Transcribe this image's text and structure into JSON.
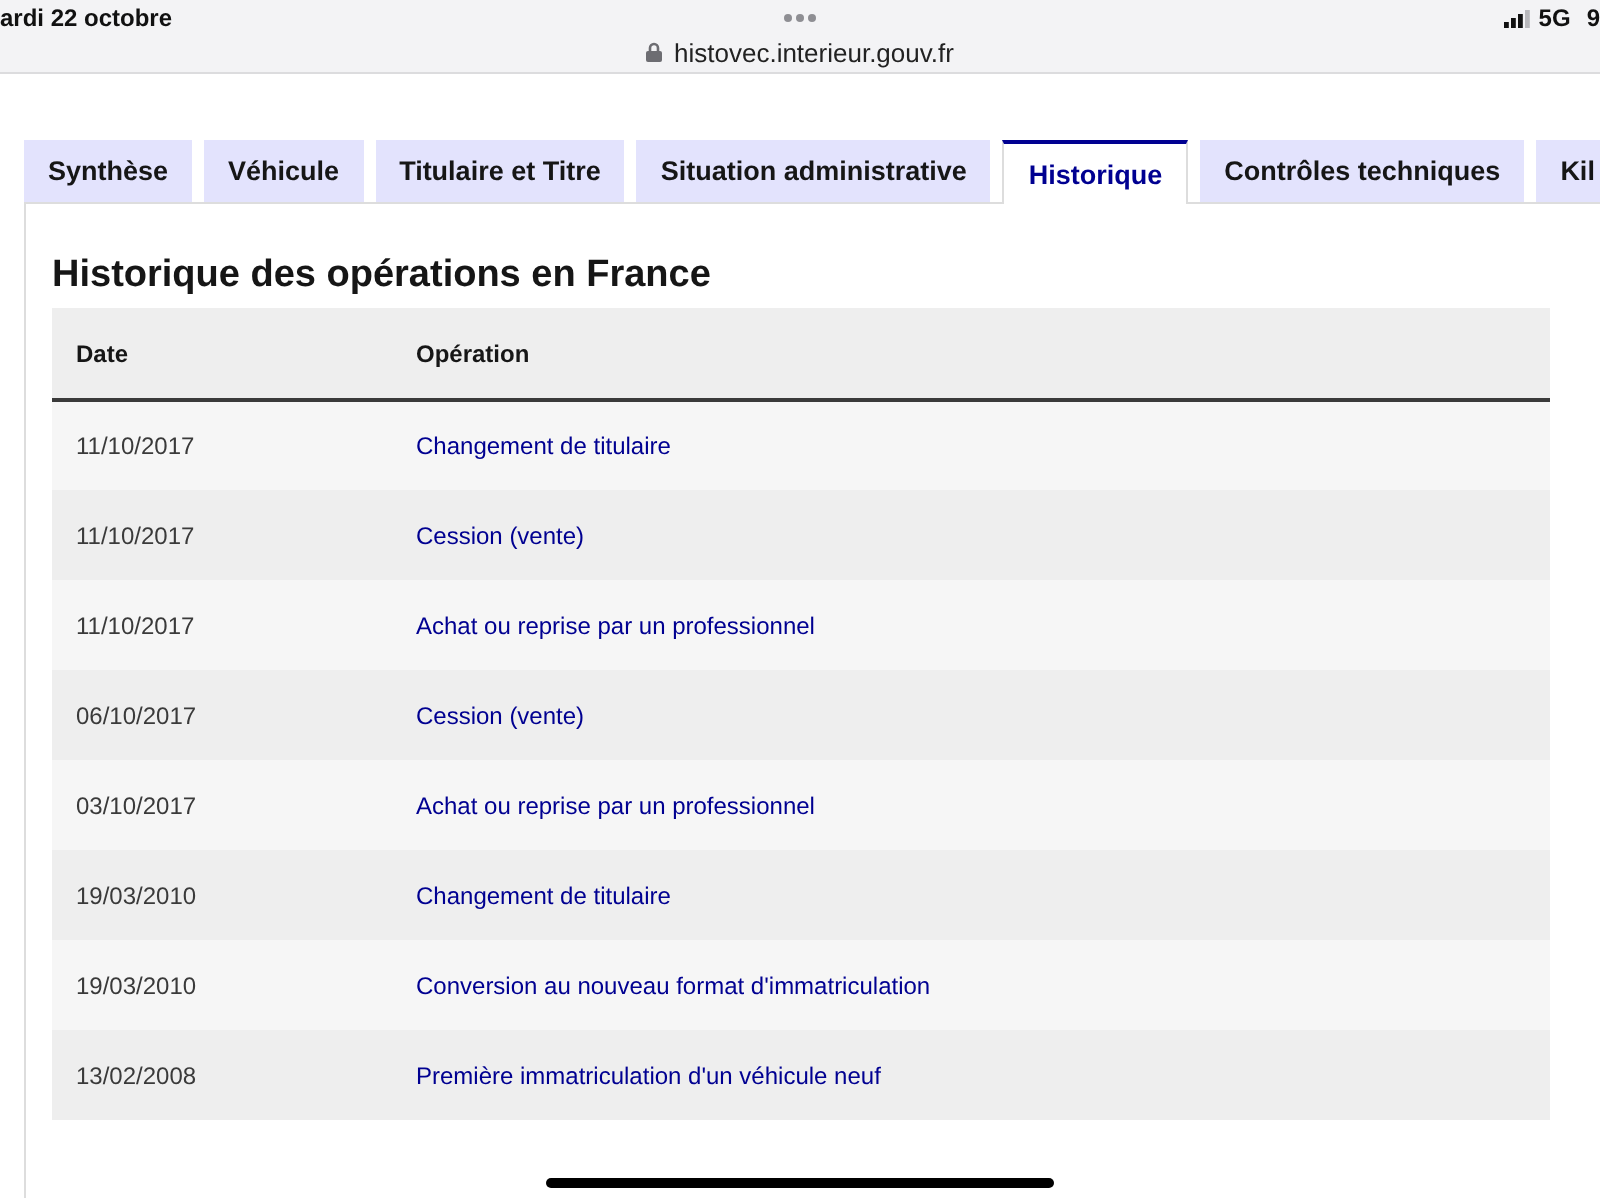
{
  "status_bar": {
    "date": "ardi 22 octobre",
    "url": "histovec.interieur.gouv.fr",
    "network": "5G",
    "battery": "9"
  },
  "tabs": [
    {
      "label": "Synthèse",
      "selected": false
    },
    {
      "label": "Véhicule",
      "selected": false
    },
    {
      "label": "Titulaire et Titre",
      "selected": false
    },
    {
      "label": "Situation administrative",
      "selected": false
    },
    {
      "label": "Historique",
      "selected": true
    },
    {
      "label": "Contrôles techniques",
      "selected": false
    },
    {
      "label": "Kil",
      "selected": false
    }
  ],
  "section": {
    "title": "Historique des opérations en France",
    "table": {
      "columns": [
        "Date",
        "Opération"
      ],
      "rows": [
        {
          "date": "11/10/2017",
          "operation": "Changement de titulaire"
        },
        {
          "date": "11/10/2017",
          "operation": "Cession (vente)"
        },
        {
          "date": "11/10/2017",
          "operation": "Achat ou reprise par un professionnel"
        },
        {
          "date": "06/10/2017",
          "operation": "Cession (vente)"
        },
        {
          "date": "03/10/2017",
          "operation": "Achat ou reprise par un professionnel"
        },
        {
          "date": "19/03/2010",
          "operation": "Changement de titulaire"
        },
        {
          "date": "19/03/2010",
          "operation": "Conversion au nouveau format d'immatriculation"
        },
        {
          "date": "13/02/2008",
          "operation": "Première immatriculation d'un véhicule neuf"
        }
      ]
    }
  }
}
